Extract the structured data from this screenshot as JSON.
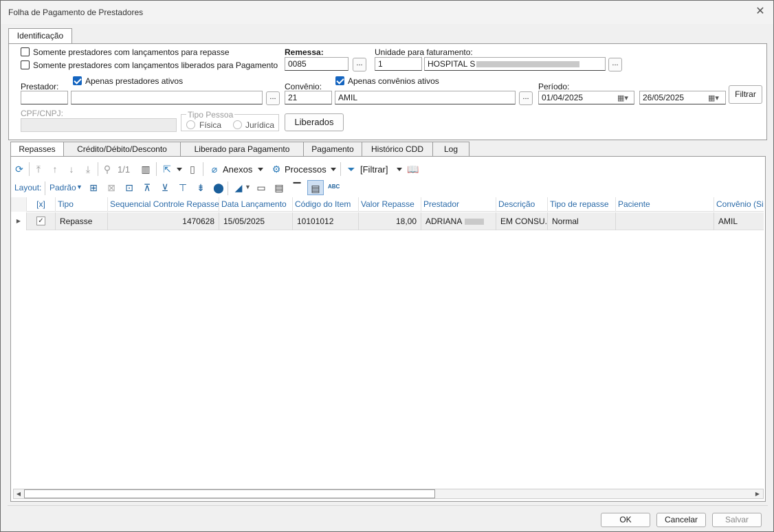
{
  "window": {
    "title": "Folha de Pagamento de Prestadores",
    "close_glyph": "✕"
  },
  "top_tab": {
    "label": "Identificação"
  },
  "filters": {
    "chk_repasse": "Somente prestadores com lançamentos para repasse",
    "chk_liberados": "Somente prestadores com lançamentos liberados para Pagamento",
    "remessa_label": "Remessa:",
    "remessa_value": "0085",
    "unidade_label": "Unidade para faturamento:",
    "unidade_code": "1",
    "unidade_name": "HOSPITAL S",
    "prestador_label": "Prestador:",
    "apenas_prestadores": "Apenas prestadores ativos",
    "convenio_label": "Convênio:",
    "apenas_convenios": "Apenas convênios ativos",
    "convenio_code": "21",
    "convenio_name": "AMIL",
    "periodo_label": "Período:",
    "periodo_inicio": "01/04/2025",
    "periodo_fim": "26/05/2025",
    "filtrar_button": "Filtrar",
    "cpf_label": "CPF/CNPJ:",
    "tipo_pessoa_label": "Tipo Pessoa",
    "fisica": "Física",
    "juridica": "Jurídica",
    "liberados_button": "Liberados",
    "dots": "..."
  },
  "tabs": [
    "Repasses",
    "Crédito/Débito/Desconto",
    "Liberado para Pagamento",
    "Pagamento",
    "Histórico CDD",
    "Log"
  ],
  "toolbar": {
    "page": "1/1",
    "anexos": "Anexos",
    "processos": "Processos",
    "filtrar": "[Filtrar]",
    "layout_label": "Layout:",
    "layout_value": "Padrão"
  },
  "grid": {
    "columns": [
      "[x]",
      "Tipo",
      "Sequencial Controle Repasse",
      "Data Lançamento",
      "Código do Item",
      "Valor Repasse",
      "Prestador",
      "Descrição",
      "Tipo de repasse",
      "Paciente",
      "Convênio (Sigl"
    ],
    "rows": [
      {
        "tipo": "Repasse",
        "sequencial": "1470628",
        "data": "15/05/2025",
        "codigo": "10101012",
        "valor": "18,00",
        "prestador": "ADRIANA",
        "descricao": "EM CONSU...",
        "tipo_repasse": "Normal",
        "paciente": "",
        "convenio": "AMIL"
      }
    ]
  },
  "footer": {
    "ok": "OK",
    "cancelar": "Cancelar",
    "salvar": "Salvar"
  }
}
